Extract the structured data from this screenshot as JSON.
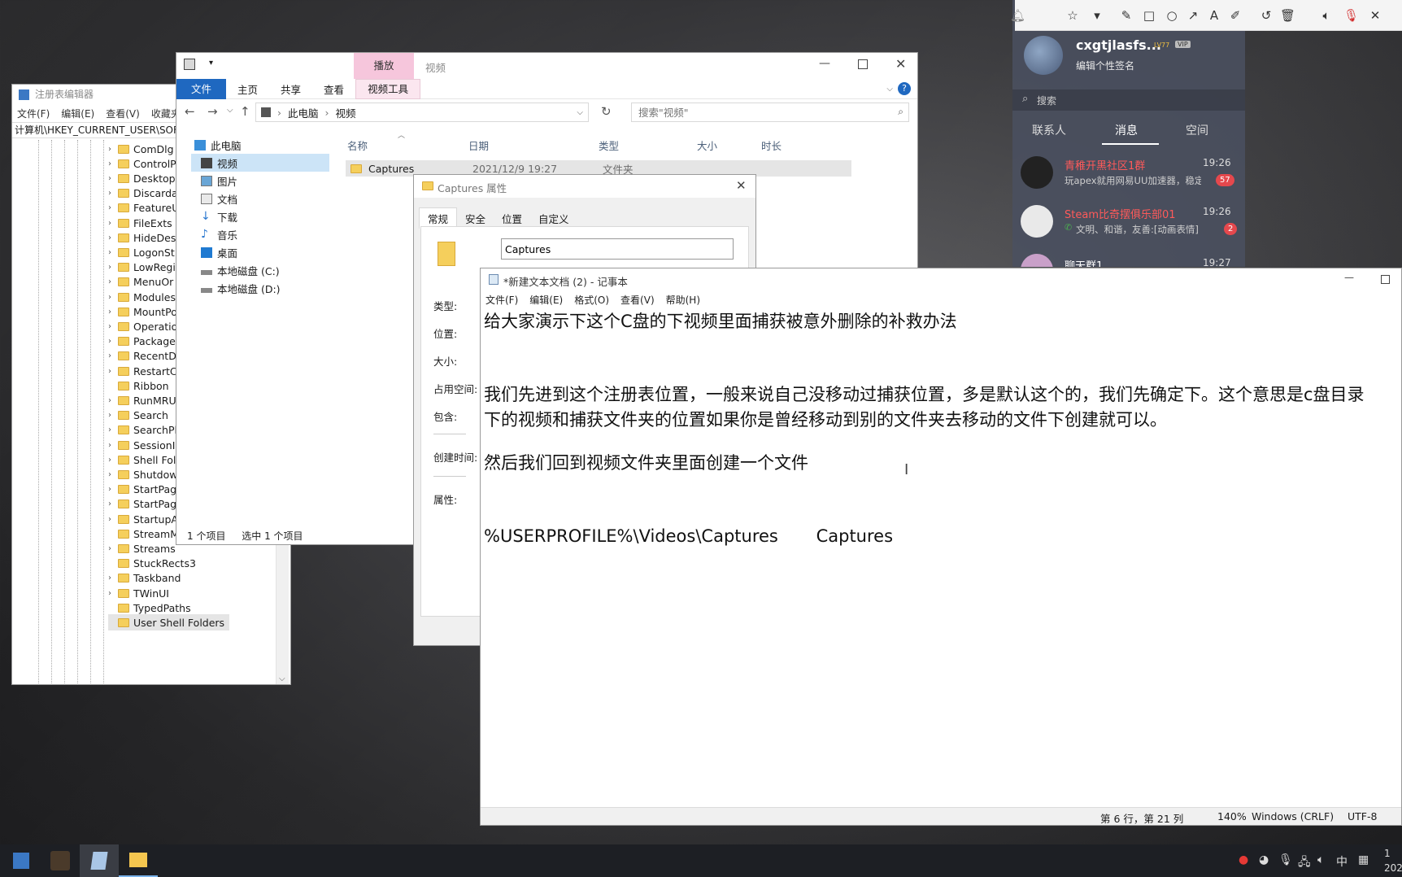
{
  "regedit": {
    "title": "注册表编辑器",
    "menu": [
      "文件(F)",
      "编辑(E)",
      "查看(V)",
      "收藏夹"
    ],
    "address": "计算机\\HKEY_CURRENT_USER\\SOF",
    "items": [
      "ComDlg",
      "ControlP",
      "Desktop",
      "Discarda",
      "FeatureU",
      "FileExts",
      "HideDes",
      "LogonSt",
      "LowRegi",
      "MenuOr",
      "Modules",
      "MountPo",
      "Operatio",
      "Package",
      "RecentD",
      "RestartC",
      "Ribbon",
      "RunMRU",
      "Search",
      "SearchPl",
      "SessionI",
      "Shell Fol",
      "Shutdow",
      "StartPag",
      "StartPag",
      "StartupApproved",
      "StreamMRU",
      "Streams",
      "StuckRects3",
      "Taskband",
      "TWinUI",
      "TypedPaths",
      "User Shell Folders"
    ]
  },
  "explorer": {
    "contextual_tab": "播放",
    "title": "视频",
    "tabs": [
      "文件",
      "主页",
      "共享",
      "查看",
      "视频工具"
    ],
    "breadcrumb": [
      "此电脑",
      "视频"
    ],
    "search_placeholder": "搜索\"视频\"",
    "nav": [
      "此电脑",
      "视频",
      "图片",
      "文档",
      "下载",
      "音乐",
      "桌面",
      "本地磁盘 (C:)",
      "本地磁盘 (D:)"
    ],
    "columns": [
      "名称",
      "日期",
      "类型",
      "大小",
      "时长"
    ],
    "file": {
      "name": "Captures",
      "date": "2021/12/9 19:27",
      "type": "文件夹"
    },
    "status_count": "1 个项目",
    "status_selected": "选中 1 个项目"
  },
  "props": {
    "title": "Captures 属性",
    "tabs": [
      "常规",
      "安全",
      "位置",
      "自定义"
    ],
    "name_value": "Captures",
    "labels": [
      "类型:",
      "位置:",
      "大小:",
      "占用空间:",
      "包含:",
      "创建时间:",
      "属性:"
    ]
  },
  "notepad": {
    "title": "*新建文本文档 (2) - 记事本",
    "menu": [
      "文件(F)",
      "编辑(E)",
      "格式(O)",
      "查看(V)",
      "帮助(H)"
    ],
    "lines": [
      "给大家演示下这个C盘的下视频里面捕获被意外删除的补救办法",
      "",
      "",
      "我们先进到这个注册表位置，一般来说自己没移动过捕获位置，多是默认这个的，我们先确定下。这个意思是c盘目录",
      "下的视频和捕获文件夹的位置如果你是曾经移动到别的文件夹去移动的文件下创建就可以。",
      "",
      "然后我们回到视频文件夹里面创建一个文件 ",
      "",
      "",
      "%USERPROFILE%\\Videos\\Captures       Captures"
    ],
    "status_pos": "第 6 行，第 21 列",
    "status_zoom": "140%",
    "status_eol": "Windows (CRLF)",
    "status_enc": "UTF-8"
  },
  "qq": {
    "username": "cxgtjlasfs...",
    "level": "LV77",
    "vip": "VIP",
    "signature": "编辑个性签名",
    "search_placeholder": "搜索",
    "tabs": [
      "联系人",
      "消息",
      "空间"
    ],
    "chats": [
      {
        "name": "青稚开黑社区1群",
        "time": "19:26",
        "preview": "玩apex就用网易UU加速器，稳定",
        "badge": "57"
      },
      {
        "name": "Steam比奇摆俱乐部01",
        "time": "19:26",
        "preview": "文明、和谐，友善:[动画表情]",
        "badge": "2"
      },
      {
        "name": "聊天群1",
        "time": "19:27",
        "preview": "",
        "badge": ""
      }
    ]
  },
  "taskbar": {
    "ime": "中",
    "clock_partial": "1\n202"
  }
}
